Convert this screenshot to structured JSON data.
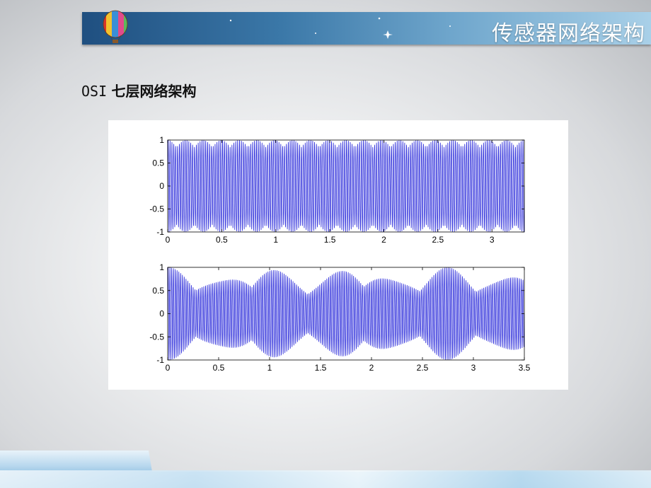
{
  "header": {
    "title": "传感器网络架构"
  },
  "subtitle": {
    "prefix": "OSI",
    "text": "七层网络架构"
  },
  "colors": {
    "signal": "#1f1fd8",
    "header_dark": "#1f4f80",
    "header_light": "#a9d0e8"
  },
  "chart_data": [
    {
      "type": "line",
      "title": "",
      "xlabel": "",
      "ylabel": "",
      "xlim": [
        0,
        3.3
      ],
      "ylim": [
        -1,
        1
      ],
      "xticks": [
        "0",
        "0.5",
        "1",
        "1.5",
        "2",
        "2.5",
        "3"
      ],
      "xtick_values": [
        0,
        0.5,
        1,
        1.5,
        2,
        2.5,
        3
      ],
      "yticks": [
        "1",
        "0.5",
        "0",
        "-0.5",
        "-1"
      ],
      "ytick_values": [
        1,
        0.5,
        0,
        -0.5,
        -1
      ],
      "signal": {
        "carrier_cycles": 190,
        "envelope_min": 0.85,
        "envelope_period": 0.165
      },
      "grid": false
    },
    {
      "type": "line",
      "title": "",
      "xlabel": "",
      "ylabel": "",
      "xlim": [
        0,
        3.5
      ],
      "ylim": [
        -1,
        1
      ],
      "xticks": [
        "0",
        "0.5",
        "1",
        "1.5",
        "2",
        "2.5",
        "3",
        "3.5"
      ],
      "xtick_values": [
        0,
        0.5,
        1,
        1.5,
        2,
        2.5,
        3,
        3.5
      ],
      "yticks": [
        "1",
        "0.5",
        "0",
        "-0.5",
        "-1"
      ],
      "ytick_values": [
        1,
        0.5,
        0,
        -0.5,
        -1
      ],
      "signal": {
        "carrier_cycles": 200,
        "envelope_min": 0.6,
        "envelope_period": 0.55
      },
      "grid": false
    }
  ]
}
